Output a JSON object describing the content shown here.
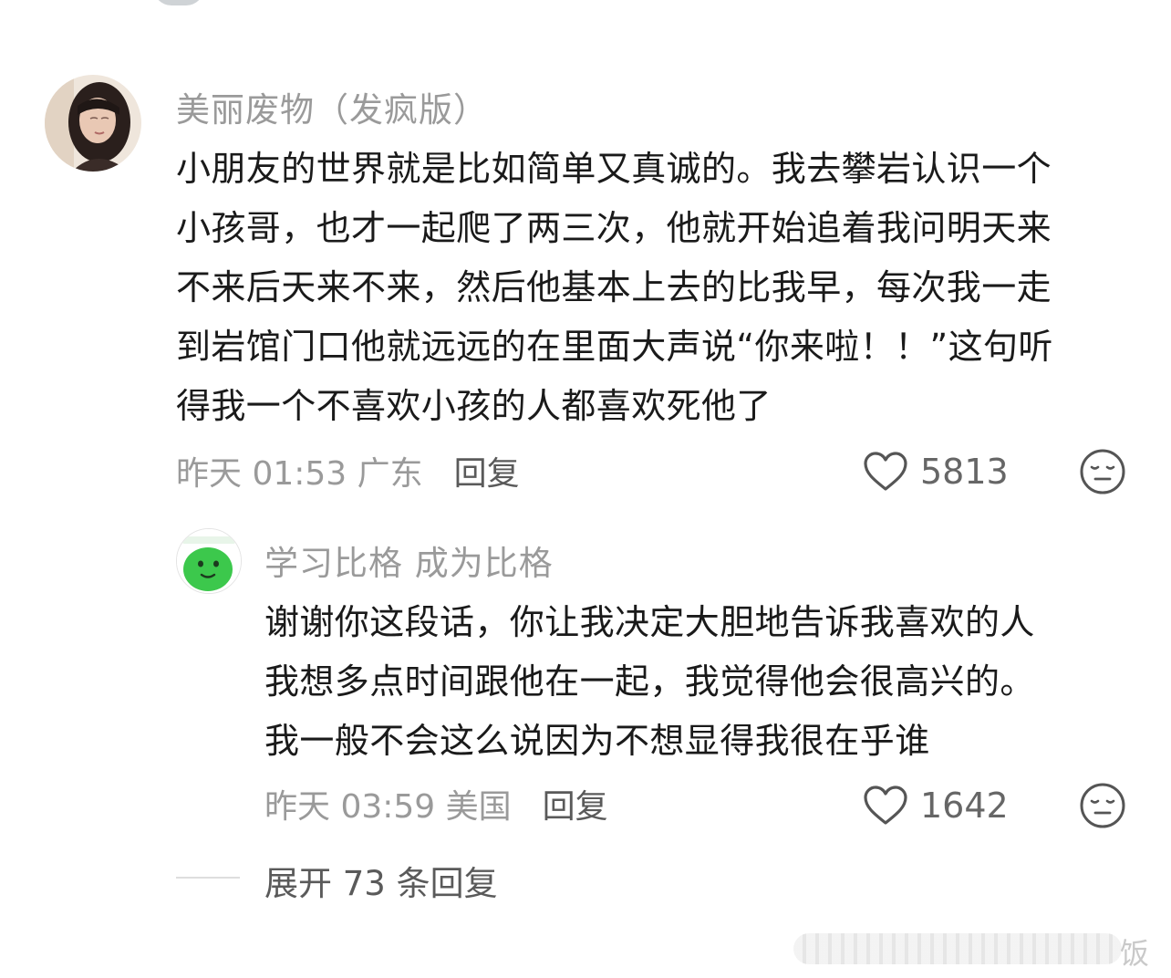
{
  "comment": {
    "username": "美丽废物（发疯版）",
    "content_lines": [
      "小朋友的世界就是比如简单又真诚的。我去攀岩认识一个",
      "小孩哥，也才一起爬了两三次，他就开始追着我问明天来",
      "不来后天来不来，然后他基本上去的比我早，每次我一走",
      "到岩馆门口他就远远的在里面大声说“你来啦！！”这句听",
      "得我一个不喜欢小孩的人都喜欢死他了"
    ],
    "time_location": "昨天 01:53 广东",
    "reply_label": "回复",
    "like_count": "5813",
    "like_icon": "heart-outline-icon",
    "dislike_icon": "neutral-face-icon"
  },
  "reply": {
    "username": "学习比格 成为比格",
    "content_lines": [
      "谢谢你这段话，你让我决定大胆地告诉我喜欢的人",
      "我想多点时间跟他在一起，我觉得他会很高兴的。",
      "我一般不会这么说因为不想显得我很在乎谁"
    ],
    "time_location": "昨天 03:59 美国",
    "reply_label": "回复",
    "like_count": "1642",
    "like_icon": "heart-outline-icon",
    "dislike_icon": "neutral-face-icon"
  },
  "expand": {
    "label": "展开 73 条回复"
  },
  "watermark": {
    "text": "饭"
  },
  "colors": {
    "text_primary": "#1a1a1a",
    "text_secondary": "#9a9a9a",
    "action_text": "#5a5a5a",
    "avatar_green": "#3cc84c"
  }
}
